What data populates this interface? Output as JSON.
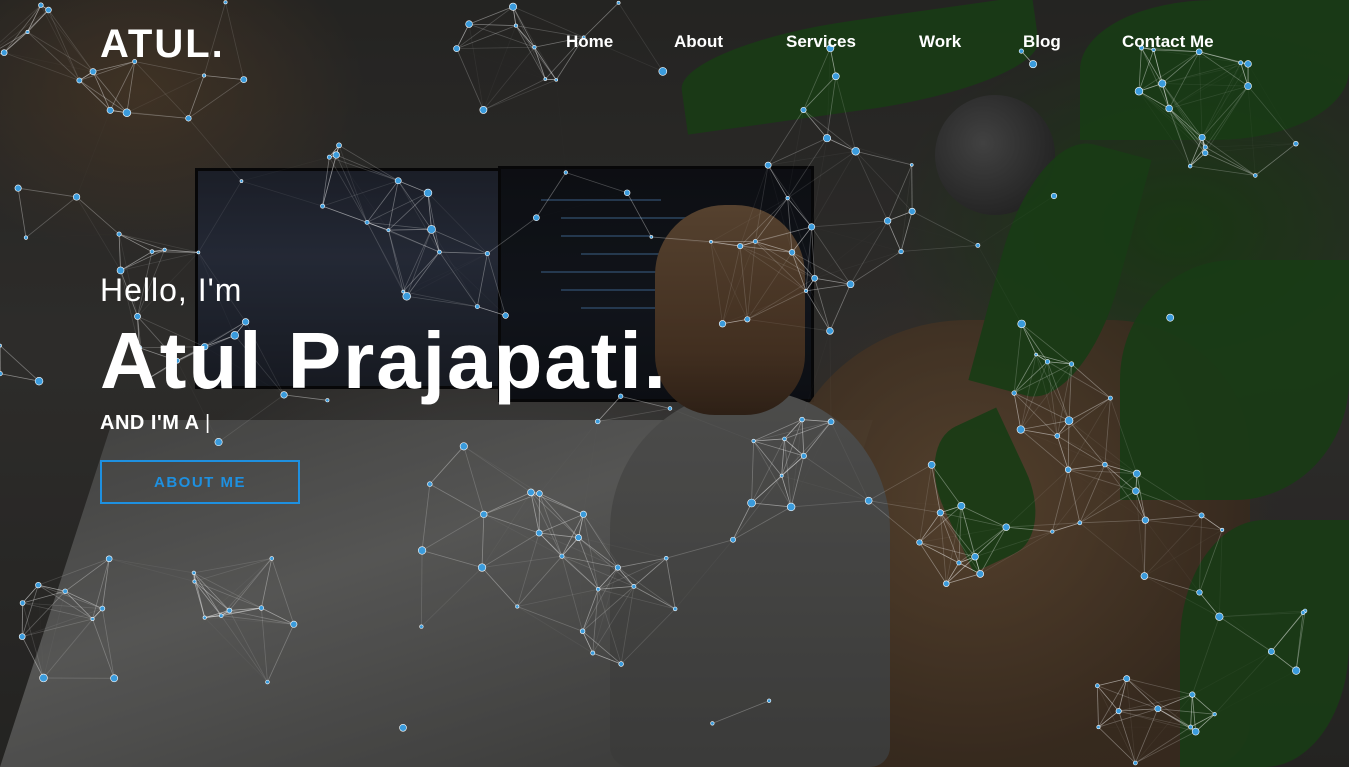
{
  "header": {
    "logo": "ATUL.",
    "nav": [
      {
        "label": "Home"
      },
      {
        "label": "About"
      },
      {
        "label": "Services"
      },
      {
        "label": "Work"
      },
      {
        "label": "Blog"
      },
      {
        "label": "Contact Me"
      }
    ]
  },
  "hero": {
    "greeting": "Hello, I'm",
    "name": "Atul Prajapati.",
    "typed_prefix": "AND I'M A",
    "typed_cursor": "|",
    "button_label": "ABOUT ME"
  },
  "colors": {
    "accent": "#1e90e0",
    "text": "#ffffff",
    "network_node": "#3a9bdc"
  }
}
